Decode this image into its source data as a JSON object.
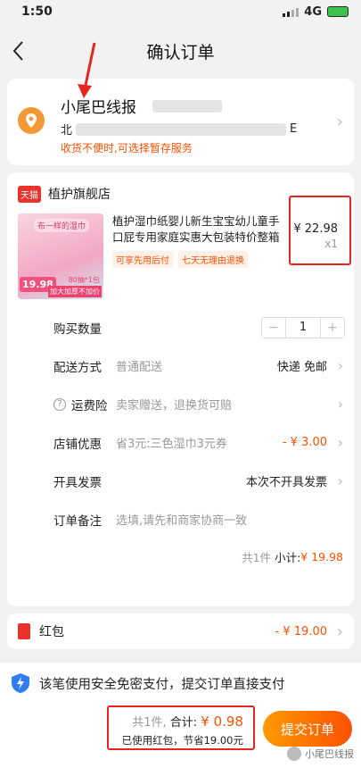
{
  "status": {
    "time": "1:50",
    "network": "4G"
  },
  "header": {
    "title": "确认订单",
    "back_icon": "chevron-left-icon"
  },
  "address": {
    "name": "小尾巴线报",
    "line_prefix": "北",
    "line_suffix": "E",
    "note": "收货不便时,可选择暂存服务"
  },
  "shop": {
    "badge": "天猫",
    "name": "植护旗舰店"
  },
  "product": {
    "title": "植护湿巾纸婴儿新生宝宝幼儿童手口屁专用家庭实惠大包装特价整箱",
    "tags": [
      "可享先用后付",
      "七天无理由退换"
    ],
    "price": "¥ 22.98",
    "qty": "x1",
    "image_caption": "布一样的湿巾",
    "image_price": "19.98",
    "image_promo": "加大加厚不加价",
    "image_count": "80抽*1包"
  },
  "rows": {
    "quantity_label": "购买数量",
    "quantity_value": "1",
    "delivery_label": "配送方式",
    "delivery_mid": "普通配送",
    "delivery_value": "快递 免邮",
    "insurance_label": "运费险",
    "insurance_mid": "卖家赠送，退换货可赔",
    "discount_label": "店铺优惠",
    "discount_mid": "省3元:三色湿巾3元券",
    "discount_value": "- ¥ 3.00",
    "invoice_label": "开具发票",
    "invoice_value": "本次不开具发票",
    "remark_label": "订单备注",
    "remark_placeholder": "选填,请先和商家协商一致"
  },
  "subtotal": {
    "count": "共1件",
    "label": "小计:",
    "amount": "¥ 19.98"
  },
  "redpacket": {
    "label": "红包",
    "value": "- ¥ 19.00"
  },
  "secure": {
    "text": "该笔使用安全免密支付，提交订单直接支付"
  },
  "pay": {
    "count": "共1件,",
    "total_label": "合计:",
    "total": "¥ 0.98",
    "saved": "已使用红包，节省19.00元",
    "submit": "提交订单"
  },
  "watermark": "小尾巴线报",
  "colors": {
    "accent": "#ff5000",
    "highlight": "#e6261f"
  }
}
